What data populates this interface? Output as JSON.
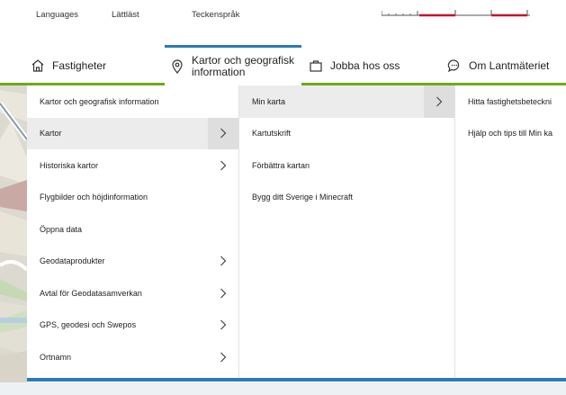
{
  "top_links": [
    "Languages",
    "Lättläst",
    "Teckenspråk"
  ],
  "nav": {
    "items": [
      {
        "label": "Fastigheter",
        "icon": "house-icon"
      },
      {
        "label": "Kartor och geografisk information",
        "icon": "location-pin-icon",
        "active": true
      },
      {
        "label": "Jobba hos oss",
        "icon": "briefcase-icon"
      },
      {
        "label": "Om Lantmäteriet",
        "icon": "chat-bubble-icon"
      }
    ]
  },
  "menu": {
    "col1": [
      {
        "label": "Kartor och geografisk information",
        "chevron": false
      },
      {
        "label": "Kartor",
        "chevron": true,
        "selected": true
      },
      {
        "label": "Historiska kartor",
        "chevron": true
      },
      {
        "label": "Flygbilder och höjdinformation",
        "chevron": false
      },
      {
        "label": "Öppna data",
        "chevron": false
      },
      {
        "label": "Geodataprodukter",
        "chevron": true
      },
      {
        "label": "Avtal för Geodatasamverkan",
        "chevron": true
      },
      {
        "label": "GPS, geodesi och Swepos",
        "chevron": true
      },
      {
        "label": "Ortnamn",
        "chevron": true
      }
    ],
    "col2": [
      {
        "label": "Min karta",
        "chevron": true,
        "selected": true
      },
      {
        "label": "Kartutskrift",
        "chevron": false
      },
      {
        "label": "Förbättra kartan",
        "chevron": false
      },
      {
        "label": "Bygg ditt Sverige i Minecraft",
        "chevron": false
      }
    ],
    "col3": [
      {
        "label": "Hitta fastighetsbeteckni"
      },
      {
        "label": "Hjälp och tips till Min ka"
      }
    ]
  },
  "colors": {
    "accent_blue": "#2b7bb9",
    "accent_green": "#6aaa1e",
    "brand_red": "#c8102e"
  }
}
